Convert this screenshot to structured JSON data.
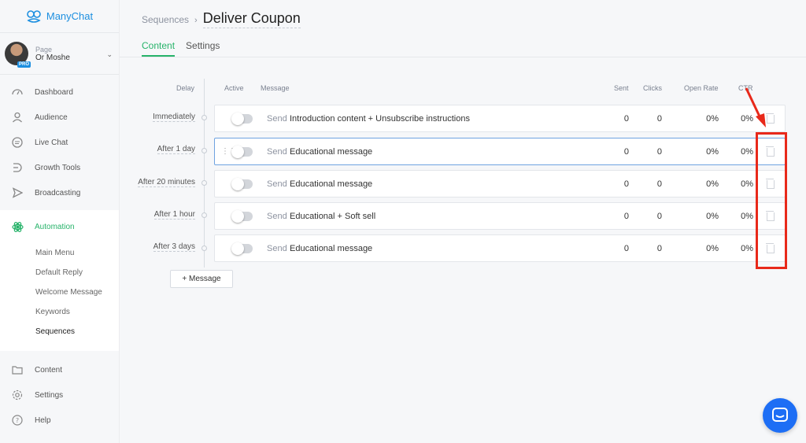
{
  "app": {
    "name": "ManyChat"
  },
  "page_account": {
    "label": "Page",
    "name": "Or Moshe",
    "badge": "PRO"
  },
  "nav": {
    "items": [
      {
        "label": "Dashboard",
        "icon": "dashboard-icon"
      },
      {
        "label": "Audience",
        "icon": "user-icon"
      },
      {
        "label": "Live Chat",
        "icon": "chat-icon"
      },
      {
        "label": "Growth Tools",
        "icon": "growth-icon"
      },
      {
        "label": "Broadcasting",
        "icon": "send-icon"
      }
    ],
    "automation": {
      "label": "Automation",
      "icon": "automation-icon",
      "sub": [
        "Main Menu",
        "Default Reply",
        "Welcome Message",
        "Keywords",
        "Sequences"
      ]
    },
    "after": [
      {
        "label": "Content",
        "icon": "folder-icon"
      },
      {
        "label": "Settings",
        "icon": "gear-icon"
      },
      {
        "label": "Help",
        "icon": "help-icon"
      }
    ]
  },
  "header": {
    "breadcrumb": "Sequences",
    "title": "Deliver Coupon",
    "tabs": [
      "Content",
      "Settings"
    ]
  },
  "table": {
    "columns": {
      "delay": "Delay",
      "active": "Active",
      "message": "Message",
      "sent": "Sent",
      "clicks": "Clicks",
      "open_rate": "Open Rate",
      "ctr": "CTR"
    },
    "rows": [
      {
        "delay": "Immediately",
        "send": "Send",
        "message": "Introduction content + Unsubscribe instructions",
        "sent": "0",
        "clicks": "0",
        "open_rate": "0%",
        "ctr": "0%"
      },
      {
        "delay": "After 1 day",
        "send": "Send",
        "message": "Educational message",
        "sent": "0",
        "clicks": "0",
        "open_rate": "0%",
        "ctr": "0%"
      },
      {
        "delay": "After 20 minutes",
        "send": "Send",
        "message": "Educational message",
        "sent": "0",
        "clicks": "0",
        "open_rate": "0%",
        "ctr": "0%"
      },
      {
        "delay": "After 1 hour",
        "send": "Send",
        "message": "Educational + Soft sell",
        "sent": "0",
        "clicks": "0",
        "open_rate": "0%",
        "ctr": "0%"
      },
      {
        "delay": "After 3 days",
        "send": "Send",
        "message": "Educational message",
        "sent": "0",
        "clicks": "0",
        "open_rate": "0%",
        "ctr": "0%"
      }
    ],
    "add_button": "+ Message"
  },
  "colors": {
    "brand": "#1d8fe0",
    "accent": "#27b36a",
    "annotation": "#e8291a",
    "chat": "#1d6ef5"
  }
}
